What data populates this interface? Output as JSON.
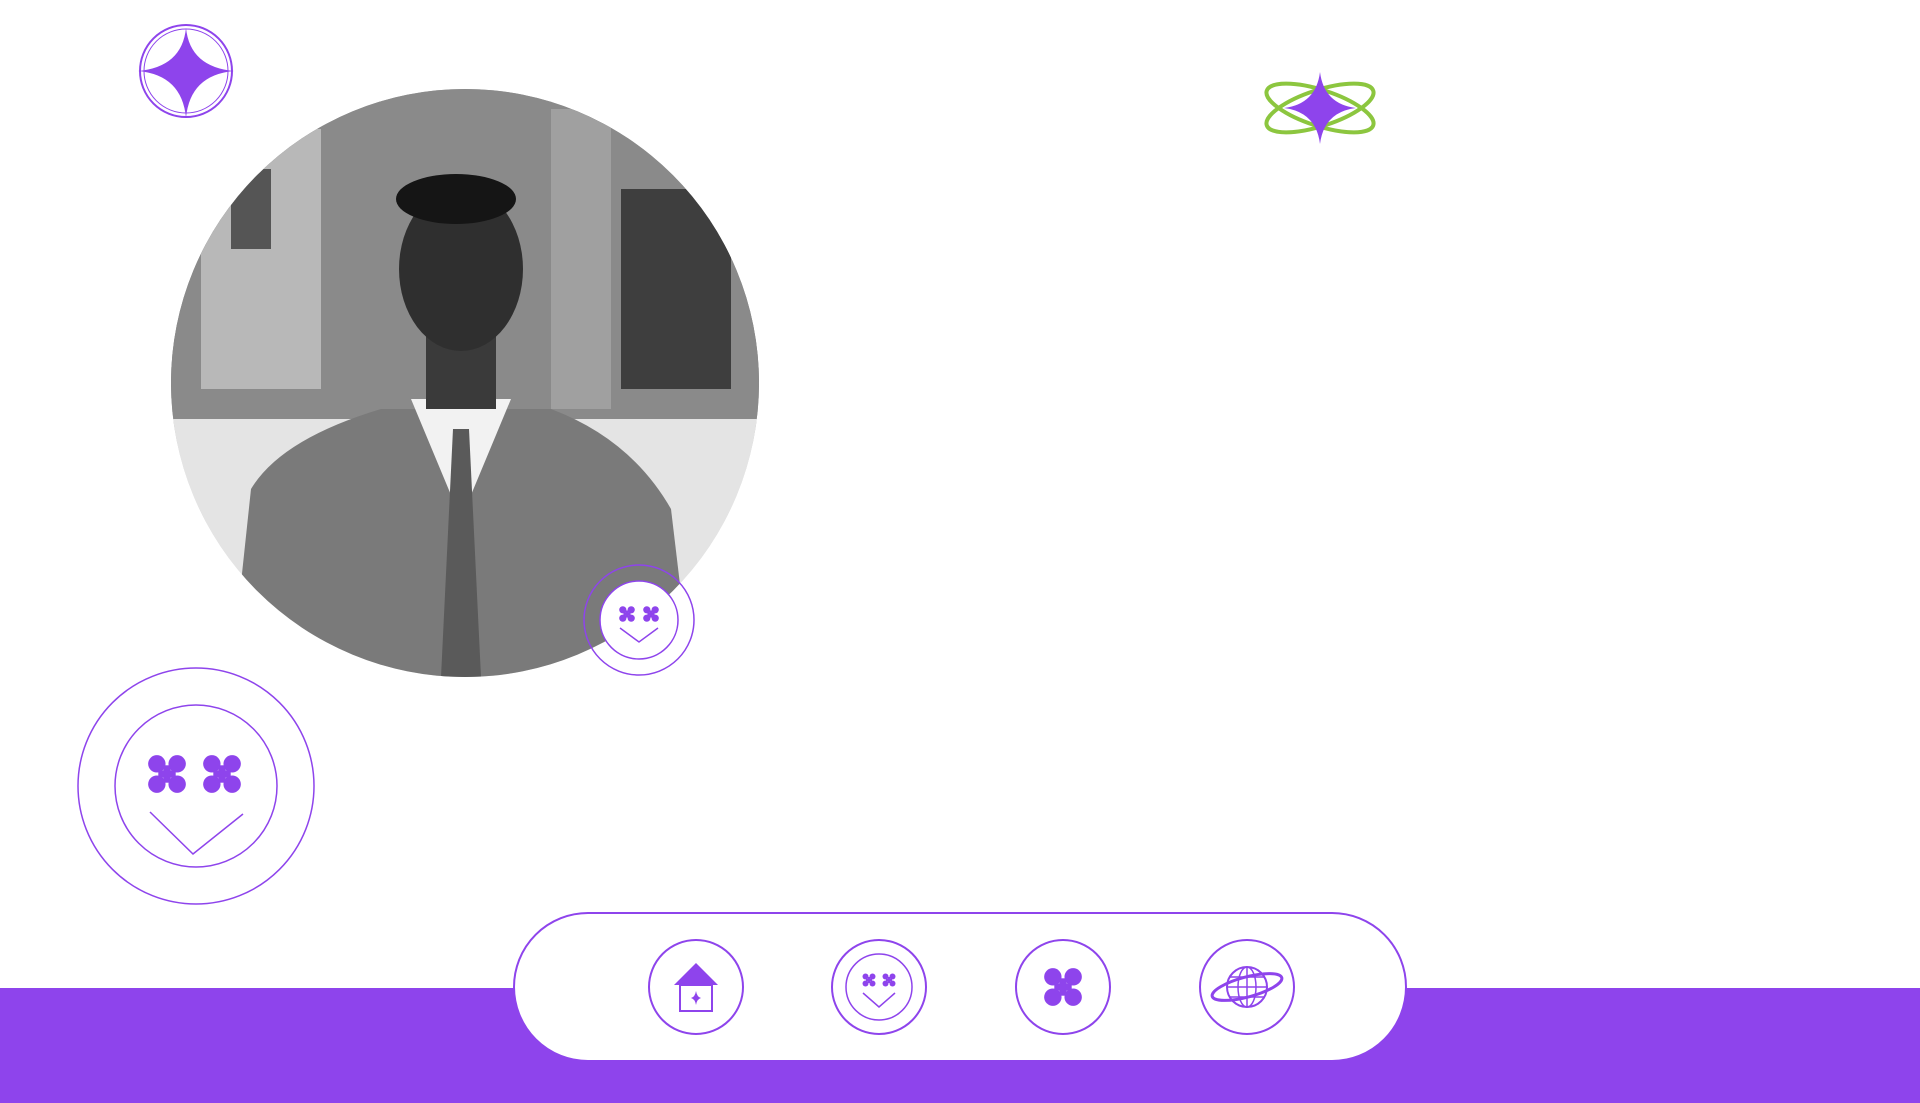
{
  "colors": {
    "accent": "#8e44ec",
    "secondary": "#8cc63f",
    "background": "#ffffff"
  },
  "decorations": {
    "top_left": "sparkle-circle-icon",
    "top_right": "atom-sparkle-icon",
    "large_badge": "smiley-face-icon",
    "photo_badge": "smiley-face-icon"
  },
  "profile_photo": {
    "description_icon": "profile-photo"
  },
  "nav": {
    "items": [
      {
        "id": "home",
        "icon": "home-icon"
      },
      {
        "id": "smiley",
        "icon": "smiley-face-icon"
      },
      {
        "id": "flower",
        "icon": "flower-icon"
      },
      {
        "id": "globe",
        "icon": "globe-icon"
      }
    ]
  }
}
